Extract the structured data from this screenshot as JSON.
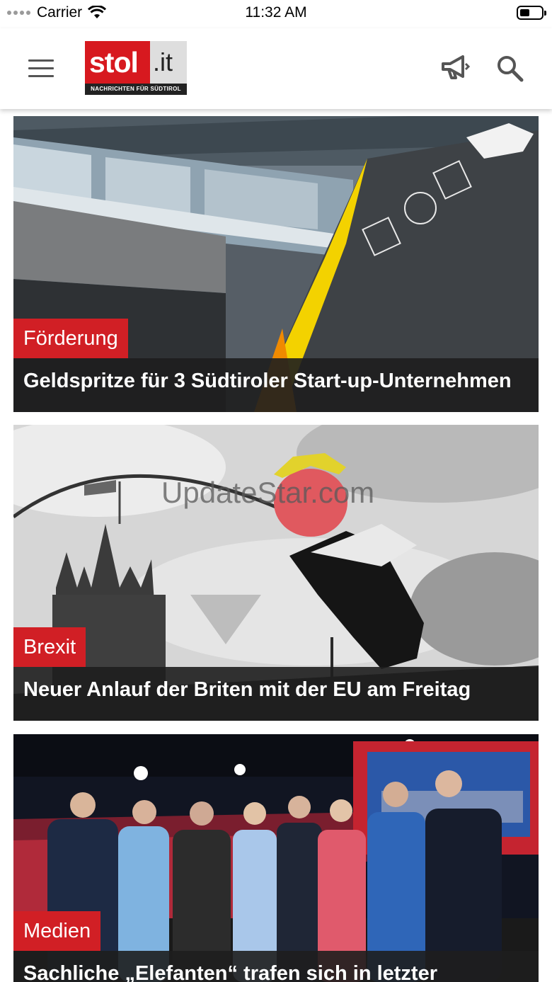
{
  "status_bar": {
    "carrier": "Carrier",
    "time": "11:32 AM"
  },
  "header": {
    "logo": {
      "main": "stol",
      "suffix": ".it",
      "tagline": "NACHRICHTEN FÜR SÜDTIROL"
    },
    "icons": [
      "menu-icon",
      "megaphone-icon",
      "search-icon"
    ]
  },
  "articles": [
    {
      "tag": "Förderung",
      "headline": "Geldspritze für 3 Südtiroler Start-up-Unternehmen"
    },
    {
      "tag": "Brexit",
      "headline": "Neuer Anlauf der Briten mit der EU am Freitag"
    },
    {
      "tag": "Medien",
      "headline": "Sachliche „Elefanten“ trafen sich in letzter"
    }
  ],
  "watermark": "UpdateStar.com",
  "colors": {
    "accent": "#d11f25",
    "caption_bg": "#1e1e1e"
  }
}
